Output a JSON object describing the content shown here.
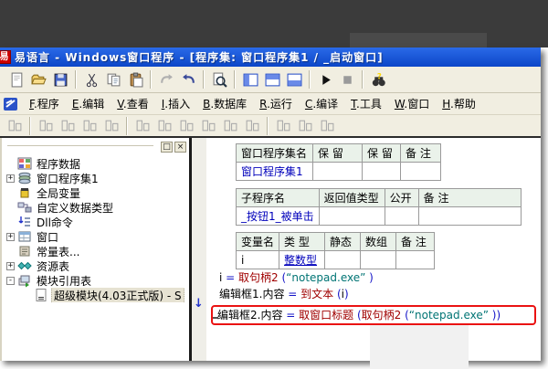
{
  "window": {
    "title": "易语言 - Windows窗口程序 - [程序集: 窗口程序集1 / _启动窗口]",
    "logo_glyph": "易"
  },
  "toolbar_main": {
    "icons": [
      "new-file",
      "open-folder",
      "save",
      "sep",
      "cut",
      "copy",
      "paste",
      "sep",
      "redo-disabled",
      "undo",
      "sep",
      "zoom-search",
      "sep",
      "layout-left",
      "layout-top",
      "layout-bottom",
      "sep",
      "run",
      "stop",
      "sep",
      "find-binoculars"
    ]
  },
  "menu": {
    "items": [
      {
        "key": "F",
        "label": "程序"
      },
      {
        "key": "E",
        "label": "编辑"
      },
      {
        "key": "V",
        "label": "查看"
      },
      {
        "key": "I",
        "label": "插入"
      },
      {
        "key": "B",
        "label": "数据库"
      },
      {
        "key": "R",
        "label": "运行"
      },
      {
        "key": "C",
        "label": "编译"
      },
      {
        "key": "T",
        "label": "工具"
      },
      {
        "key": "W",
        "label": "窗口"
      },
      {
        "key": "H",
        "label": "帮助"
      }
    ]
  },
  "toolbar_align": {
    "icons": [
      "align-generic",
      "sep",
      "align-generic",
      "align-generic",
      "align-generic",
      "align-generic",
      "sep",
      "align-generic",
      "align-generic",
      "align-generic",
      "align-generic",
      "align-generic",
      "align-generic",
      "sep",
      "align-generic",
      "align-generic",
      "align-generic"
    ]
  },
  "tree": {
    "float_button": "□",
    "close_button": "×",
    "items": [
      {
        "icon": "program-data",
        "label": "程序数据",
        "expand": null,
        "child": false,
        "selected": false
      },
      {
        "icon": "assembly",
        "label": "窗口程序集1",
        "expand": "+",
        "child": false,
        "selected": false
      },
      {
        "icon": "global-var",
        "label": "全局变量",
        "expand": null,
        "child": false,
        "selected": false
      },
      {
        "icon": "custom-type",
        "label": "自定义数据类型",
        "expand": null,
        "child": false,
        "selected": false
      },
      {
        "icon": "dll-cmd",
        "label": "Dll命令",
        "expand": null,
        "child": false,
        "selected": false
      },
      {
        "icon": "window",
        "label": "窗口",
        "expand": "+",
        "child": false,
        "selected": false
      },
      {
        "icon": "const-table",
        "label": "常量表...",
        "expand": null,
        "child": false,
        "selected": false
      },
      {
        "icon": "resource-table",
        "label": "资源表",
        "expand": "+",
        "child": false,
        "selected": false
      },
      {
        "icon": "module-table",
        "label": "模块引用表",
        "expand": "-",
        "child": false,
        "selected": false
      },
      {
        "icon": "module-doc",
        "label": "超级模块(4.03正式版) - S",
        "expand": null,
        "child": true,
        "selected": true
      }
    ]
  },
  "editor": {
    "tables": [
      {
        "cls": "t1",
        "widths": [
          84,
          54,
          42,
          44
        ],
        "header": [
          "窗口程序集名",
          "保 留",
          "保 留",
          "备 注"
        ],
        "rows": [
          [
            {
              "t": "窗口程序集1",
              "c": "blue"
            },
            {
              "t": ""
            },
            {
              "t": ""
            },
            {
              "t": ""
            }
          ]
        ]
      },
      {
        "cls": "t2",
        "widths": [
          89,
          72,
          37,
          112
        ],
        "header": [
          "子程序名",
          "返回值类型",
          "公开",
          "备 注"
        ],
        "rows": [
          [
            {
              "t": "_按钮1_被单击",
              "c": "blue"
            },
            {
              "t": ""
            },
            {
              "t": ""
            },
            {
              "t": ""
            }
          ]
        ]
      },
      {
        "cls": "t3",
        "widths": [
          47,
          50,
          39,
          39,
          42
        ],
        "header": [
          "变量名",
          "类 型",
          "静态",
          "数组",
          "备 注"
        ],
        "rows": [
          [
            {
              "t": "i"
            },
            {
              "t": "整数型",
              "c": "bluelink"
            },
            {
              "t": ""
            },
            {
              "t": ""
            },
            {
              "t": ""
            }
          ]
        ]
      }
    ],
    "code_lines": [
      {
        "highlighted": false,
        "tokens": [
          [
            "i",
            "v"
          ],
          [
            " = ",
            "o"
          ],
          [
            "取句柄2",
            "f"
          ],
          [
            " (",
            "o"
          ],
          [
            "“notepad.exe”",
            "s"
          ],
          [
            " )",
            "o"
          ]
        ]
      },
      {
        "highlighted": false,
        "tokens": [
          [
            "编辑框1.内容",
            "v"
          ],
          [
            " = ",
            "o"
          ],
          [
            "到文本",
            "f"
          ],
          [
            " (",
            "o"
          ],
          [
            "i",
            "v"
          ],
          [
            ")",
            "o"
          ]
        ]
      },
      {
        "highlighted": true,
        "tokens": [
          [
            "编辑框2.内容",
            "v"
          ],
          [
            " = ",
            "o"
          ],
          [
            "取窗口标题",
            "f"
          ],
          [
            " (",
            "o"
          ],
          [
            "取句柄2",
            "f"
          ],
          [
            " (",
            "o"
          ],
          [
            "“notepad.exe”",
            "s"
          ],
          [
            " )",
            "o"
          ],
          [
            ")",
            "o"
          ]
        ]
      }
    ],
    "gutter_arrow": "↓"
  },
  "colors": {
    "titlebar_blue": "#1550d2",
    "toolbar_beige": "#f1eee1",
    "table_header_green": "#eaf2ea",
    "function_red": "#a00000",
    "string_teal": "#007474",
    "operator_blue": "#1414c8",
    "link_blue": "#0000bb",
    "highlight_red": "#ea1212"
  }
}
